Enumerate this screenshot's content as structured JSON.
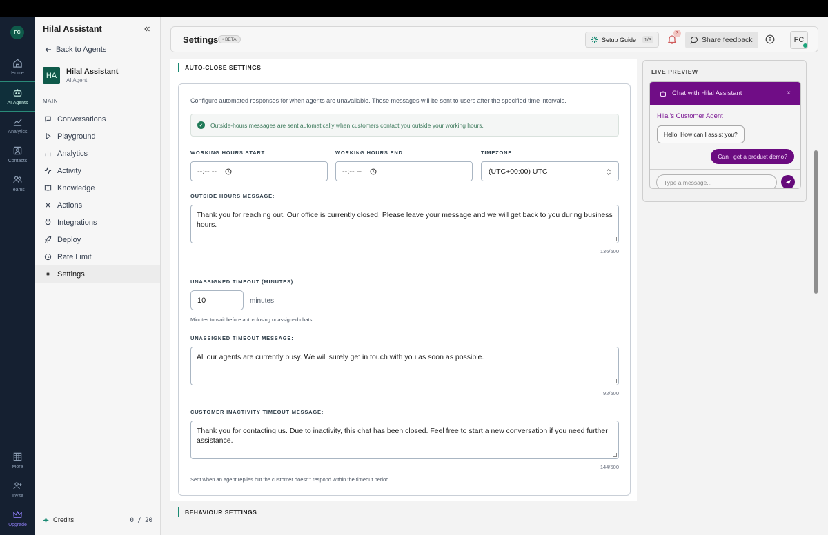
{
  "rail": {
    "avatar": "FC",
    "items": [
      {
        "label": "Home",
        "icon": "home-icon"
      },
      {
        "label": "AI Agents",
        "icon": "bot-icon"
      },
      {
        "label": "Analytics",
        "icon": "chart-icon"
      },
      {
        "label": "Contacts",
        "icon": "contacts-icon"
      },
      {
        "label": "Teams",
        "icon": "team-icon"
      }
    ],
    "bottom": [
      {
        "label": "More",
        "icon": "grid-icon"
      },
      {
        "label": "Invite",
        "icon": "invite-icon"
      },
      {
        "label": "Upgrade",
        "icon": "crown-icon"
      }
    ]
  },
  "sidebar": {
    "title": "Hilal Assistant",
    "back_label": "Back to Agents",
    "agent_initials": "HA",
    "agent_name": "Hilal Assistant",
    "agent_role": "AI Agent",
    "section_label": "MAIN",
    "items": [
      {
        "label": "Conversations",
        "icon": "chat-icon"
      },
      {
        "label": "Playground",
        "icon": "play-icon"
      },
      {
        "label": "Analytics",
        "icon": "bar-chart-icon"
      },
      {
        "label": "Activity",
        "icon": "activity-icon"
      },
      {
        "label": "Knowledge",
        "icon": "book-icon"
      },
      {
        "label": "Actions",
        "icon": "actions-icon"
      },
      {
        "label": "Integrations",
        "icon": "plug-icon"
      },
      {
        "label": "Deploy",
        "icon": "rocket-icon"
      },
      {
        "label": "Rate Limit",
        "icon": "clock-icon"
      },
      {
        "label": "Settings",
        "icon": "gear-icon"
      }
    ],
    "credits_label": "Credits",
    "credits_count": "0 / 20"
  },
  "header": {
    "title": "Settings",
    "badge": "• BETA",
    "setup_guide": "Setup Guide",
    "setup_progress": "1/3",
    "notifications": "3",
    "feedback": "Share feedback",
    "user_initials": "FC"
  },
  "autoclose": {
    "section_title": "AUTO-CLOSE SETTINGS",
    "description": "Configure automated responses for when agents are unavailable. These messages will be sent to users after the specified time intervals.",
    "note": "Outside-hours messages are sent automatically when customers contact you outside your working hours.",
    "start_label": "WORKING HOURS START:",
    "start_value": "--:-- --",
    "end_label": "WORKING HOURS END:",
    "end_value": "--:-- --",
    "timezone_label": "TIMEZONE:",
    "timezone_value": "(UTC+00:00) UTC",
    "outside_label": "OUTSIDE HOURS MESSAGE:",
    "outside_message": "Thank you for reaching out. Our office is currently closed. Please leave your message and we will get back to you during business hours.",
    "outside_count": "136/500",
    "unassigned_timeout_label": "UNASSIGNED TIMEOUT (MINUTES):",
    "unassigned_timeout_value": "10",
    "unassigned_timeout_unit": "minutes",
    "unassigned_timeout_help": "Minutes to wait before auto-closing unassigned chats.",
    "unassigned_message_label": "UNASSIGNED TIMEOUT MESSAGE:",
    "unassigned_message": "All our agents are currently busy. We will surely get in touch with you as soon as possible.",
    "unassigned_count": "92/500",
    "inactivity_label": "CUSTOMER INACTIVITY TIMEOUT MESSAGE:",
    "inactivity_message": "Thank you for contacting us. Due to inactivity, this chat has been closed. Feel free to start a new conversation if you need further assistance.",
    "inactivity_count": "144/500",
    "inactivity_help": "Sent when an agent replies but the customer doesn't respond within the timeout period."
  },
  "behaviour": {
    "section_title": "BEHAVIOUR SETTINGS"
  },
  "preview": {
    "label": "LIVE PREVIEW",
    "chat_title": "Chat with Hilal Assistant",
    "close": "×",
    "agent_name": "Hilal's Customer Agent",
    "bot_message": "Hello! How can I assist you?",
    "user_message": "Can I get a product demo?",
    "input_placeholder": "Type a message..."
  },
  "colors": {
    "accent": "#1a8a73",
    "chat_brand": "#700d86",
    "rail_bg": "#152031"
  }
}
